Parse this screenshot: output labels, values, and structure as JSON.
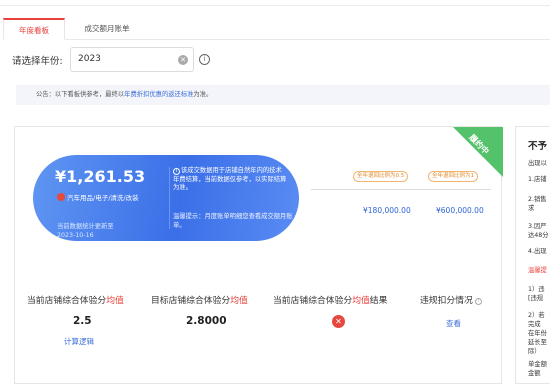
{
  "tabs": [
    {
      "label": "年度看板",
      "active": true
    },
    {
      "label": "成交额月账单",
      "active": false
    }
  ],
  "year_filter": {
    "label": "请选择年份:",
    "value": "2023"
  },
  "notice": {
    "prefix": "公告：以下看板供参考，最终以",
    "highlight": "年费折扣优惠的返还标准",
    "suffix": "为准。"
  },
  "banner": {
    "status_badge": "履约中",
    "amount": "¥1,261.53",
    "category": "汽车用品/电子/清洗/改装",
    "update_label": "当前数据统计更新至",
    "update_date": "2023-10-16",
    "note": "该成交数据用于店铺自然年内的技术年费结算，当前数据仅参考，以实际结算为准。",
    "tip": "温馨提示：月度账单明细您查看成交额月账单。"
  },
  "progress": {
    "tags": [
      "全年退回比例为0.5",
      "全年退回比例为1"
    ],
    "amounts": [
      "¥180,000.00",
      "¥600,000.00"
    ]
  },
  "metrics": [
    {
      "prefix": "当前店铺综合体验分",
      "red": "均值",
      "suffix": "",
      "value": "2.5",
      "link": "计算逻辑"
    },
    {
      "prefix": "目标店铺综合体验分",
      "red": "均值",
      "suffix": "",
      "value": "2.8000"
    },
    {
      "prefix": "当前店铺综合体验分",
      "red": "均值",
      "suffix": "结果"
    },
    {
      "prefix": "违规扣分情况",
      "red": "",
      "suffix": "",
      "link": "查看"
    }
  ],
  "colors": {
    "accent": "#e8403a",
    "link": "#3d6fd8",
    "banner": "#3b6fe8",
    "badge": "#53c26b"
  },
  "side": {
    "title": "不予",
    "lines": [
      "出现以",
      "1.店铺",
      "2.销售",
      "求",
      "3.因严",
      "达48分",
      "4.出现",
      "1）违",
      "[违规",
      "2）若",
      "完成",
      "在年份",
      "延长至",
      "际）",
      "单金额",
      "金额"
    ],
    "red_line": "温馨提"
  }
}
